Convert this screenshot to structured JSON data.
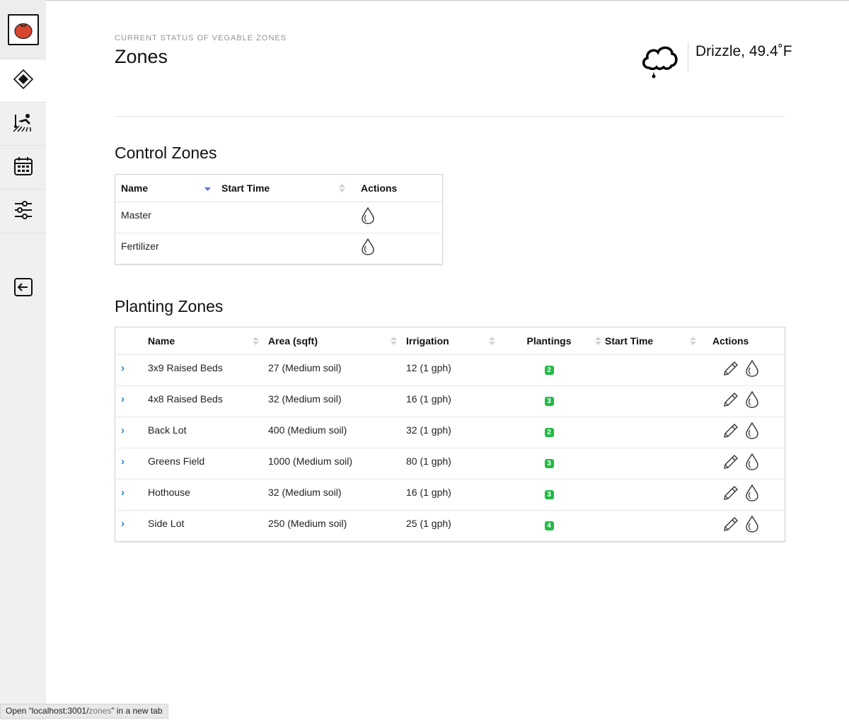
{
  "header": {
    "eyebrow": "CURRENT STATUS OF VEGABLE ZONES",
    "title": "Zones",
    "weather": "Drizzle, 49.4˚F"
  },
  "sidebar": {
    "items": [
      {
        "icon": "tomato-logo-icon"
      },
      {
        "icon": "zones-icon",
        "active": true
      },
      {
        "icon": "gardener-icon"
      },
      {
        "icon": "calendar-icon"
      },
      {
        "icon": "settings-sliders-icon"
      },
      {
        "icon": "logout-icon"
      }
    ]
  },
  "control_zones": {
    "title": "Control Zones",
    "columns": [
      "Name",
      "Start Time",
      "Actions"
    ],
    "rows": [
      {
        "name": "Master",
        "start_time": ""
      },
      {
        "name": "Fertilizer",
        "start_time": ""
      }
    ]
  },
  "planting_zones": {
    "title": "Planting Zones",
    "columns": [
      "Name",
      "Area (sqft)",
      "Irrigation",
      "Plantings",
      "Start Time",
      "Actions"
    ],
    "rows": [
      {
        "name": "3x9 Raised Beds",
        "area": "27 (Medium soil)",
        "irrigation": "12 (1 gph)",
        "plantings": "2",
        "start_time": ""
      },
      {
        "name": "4x8 Raised Beds",
        "area": "32 (Medium soil)",
        "irrigation": "16 (1 gph)",
        "plantings": "3",
        "start_time": ""
      },
      {
        "name": "Back Lot",
        "area": "400 (Medium soil)",
        "irrigation": "32 (1 gph)",
        "plantings": "2",
        "start_time": ""
      },
      {
        "name": "Greens Field",
        "area": "1000 (Medium soil)",
        "irrigation": "80 (1 gph)",
        "plantings": "3",
        "start_time": ""
      },
      {
        "name": "Hothouse",
        "area": "32 (Medium soil)",
        "irrigation": "16 (1 gph)",
        "plantings": "3",
        "start_time": ""
      },
      {
        "name": "Side Lot",
        "area": "250 (Medium soil)",
        "irrigation": "25 (1 gph)",
        "plantings": "4",
        "start_time": ""
      }
    ]
  },
  "status_bar": {
    "prefix": "Open “",
    "host": "localhost:3001/",
    "path": "zones",
    "suffix": "” in a new tab"
  },
  "colors": {
    "badge": "#21ba45",
    "chevron": "#2185d0",
    "sort_active": "#5b6fd6",
    "tomato": "#d6452d"
  }
}
